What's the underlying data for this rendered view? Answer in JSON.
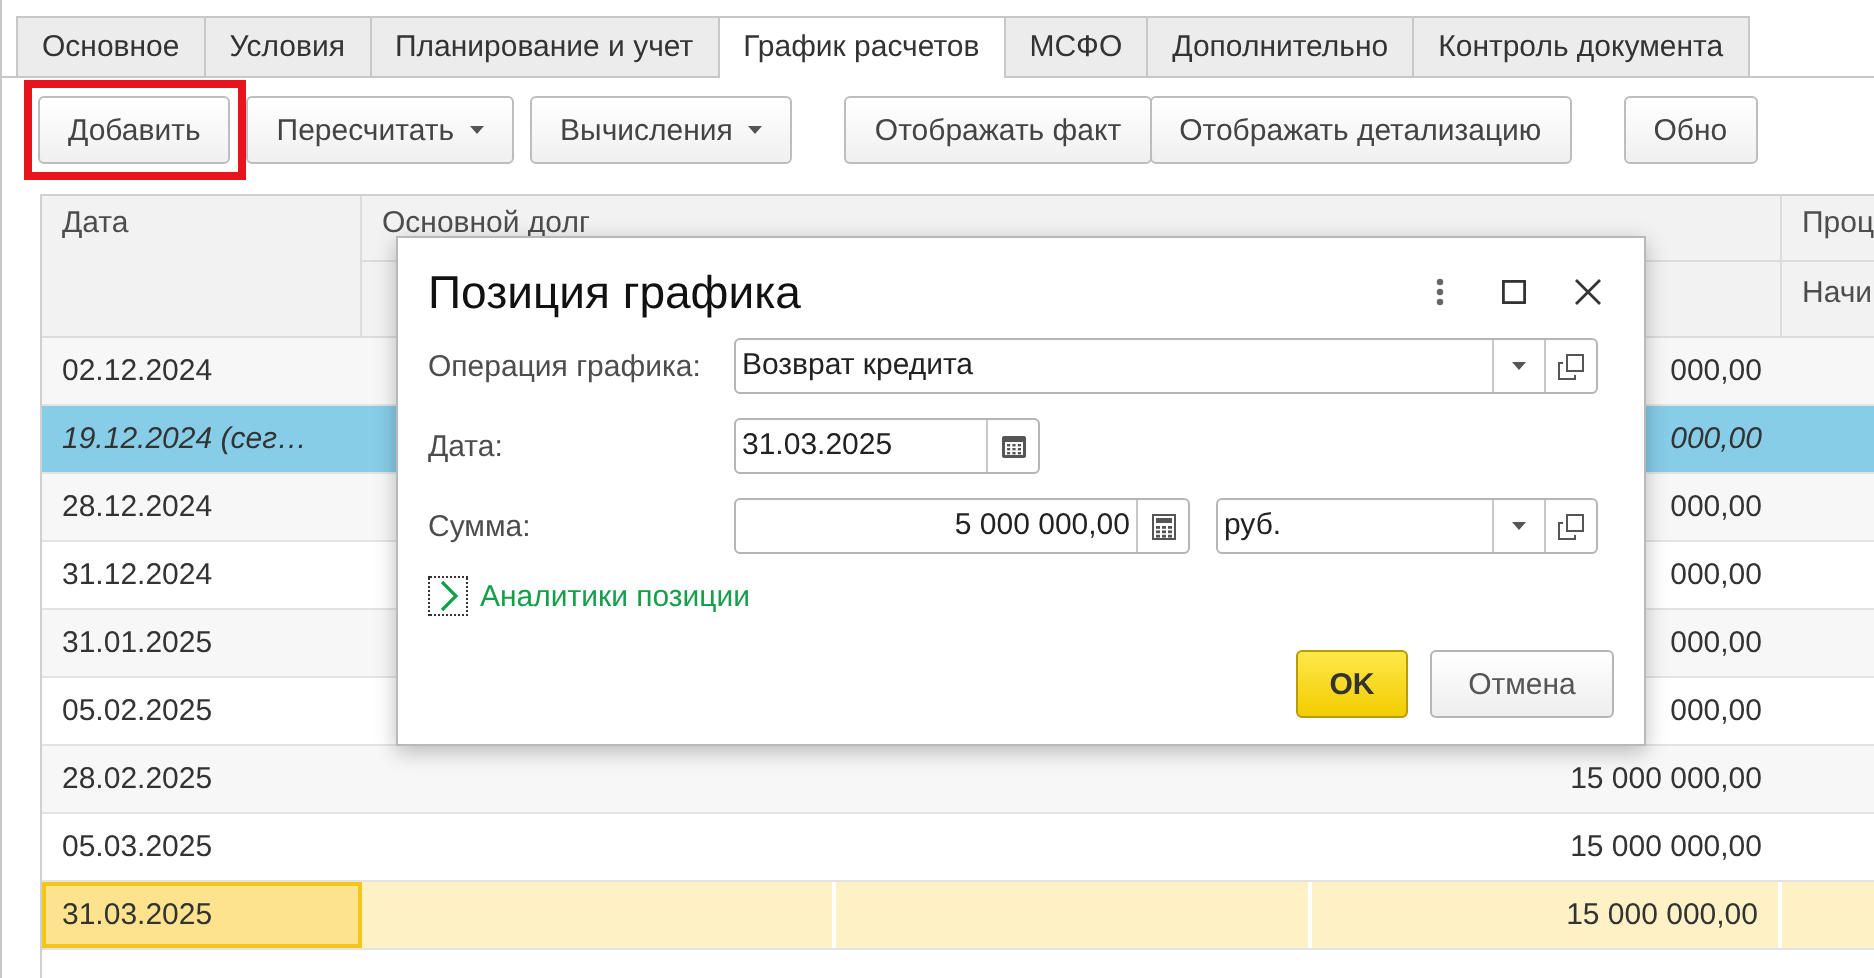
{
  "tabs": [
    {
      "label": "Основное",
      "selected": false
    },
    {
      "label": "Условия",
      "selected": false
    },
    {
      "label": "Планирование и учет",
      "selected": false
    },
    {
      "label": "График расчетов",
      "selected": true
    },
    {
      "label": "МСФО",
      "selected": false
    },
    {
      "label": "Дополнительно",
      "selected": false
    },
    {
      "label": "Контроль документа",
      "selected": false
    }
  ],
  "toolbar": [
    {
      "buttons": [
        {
          "label": "Добавить",
          "dropdown": false,
          "highlighted": true
        }
      ]
    },
    {
      "buttons": [
        {
          "label": "Пересчитать",
          "dropdown": true,
          "highlighted": false
        }
      ]
    },
    {
      "buttons": [
        {
          "label": "Вычисления",
          "dropdown": true,
          "highlighted": false
        }
      ]
    },
    {
      "buttons": [
        {
          "label": "Отображать факт",
          "dropdown": false,
          "highlighted": false
        },
        {
          "label": "Отображать детализацию",
          "dropdown": false,
          "highlighted": false
        }
      ]
    },
    {
      "buttons": [
        {
          "label": "Обно",
          "dropdown": false,
          "highlighted": false
        }
      ]
    }
  ],
  "table": {
    "header": {
      "date": "Дата",
      "group": "Основной долг",
      "column_5": "Проц",
      "column_5_sub": "Начи"
    },
    "rows": [
      {
        "date": "02.12.2024",
        "amount": "000,00",
        "current": false,
        "selected": false
      },
      {
        "date": "19.12.2024 (сег…",
        "amount": "000,00",
        "current": true,
        "selected": false
      },
      {
        "date": "28.12.2024",
        "amount": "000,00",
        "current": false,
        "selected": false
      },
      {
        "date": "31.12.2024",
        "amount": "000,00",
        "current": false,
        "selected": false
      },
      {
        "date": "31.01.2025",
        "amount": "000,00",
        "current": false,
        "selected": false
      },
      {
        "date": "05.02.2025",
        "amount": "000,00",
        "current": false,
        "selected": false
      },
      {
        "date": "28.02.2025",
        "amount": "15 000 000,00",
        "current": false,
        "selected": false
      },
      {
        "date": "05.03.2025",
        "amount": "15 000 000,00",
        "current": false,
        "selected": false
      },
      {
        "date": "31.03.2025",
        "amount": "15 000 000,00",
        "current": false,
        "selected": true
      }
    ]
  },
  "dialog": {
    "title": "Позиция графика",
    "fields": [
      {
        "kind": "choice",
        "label": "Операция графика:",
        "value": "Возврат кредита"
      },
      {
        "kind": "date",
        "label": "Дата:",
        "value": "31.03.2025"
      },
      {
        "kind": "amount",
        "label": "Сумма:",
        "value": "5 000 000,00",
        "currency": "руб."
      }
    ],
    "link": "Аналитики позиции",
    "buttons": [
      {
        "label": "OK",
        "default": true
      },
      {
        "label": "Отмена",
        "default": false
      }
    ]
  }
}
